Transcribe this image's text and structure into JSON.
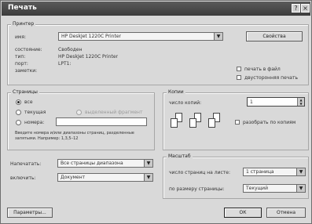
{
  "window": {
    "title": "Печать",
    "help_btn": "?",
    "close_btn": "×"
  },
  "printer": {
    "group_title": "Принтер",
    "name_label": "имя:",
    "name_value": "HP DeskJet 1220C Printer",
    "properties_btn": "Свойства",
    "status_label": "состояние:",
    "status_value": "Свободен",
    "type_label": "тип:",
    "type_value": "HP DeskJet 1220C Printer",
    "port_label": "порт:",
    "port_value": "LPT1:",
    "comment_label": "заметки:",
    "comment_value": "",
    "print_to_file": "печать в файл",
    "duplex": "двусторонняя печать"
  },
  "pages": {
    "group_title": "Страницы",
    "all": "все",
    "current": "текущая",
    "selection": "выделенный фрагмент",
    "numbers": "номера:",
    "hint": "Введите номера и/или диапазоны страниц, разделенные запятыми. Например: 1,3,5–12"
  },
  "copies": {
    "group_title": "Копии",
    "count_label": "число копий:",
    "count_value": "1",
    "collate": "разобрать по копиям"
  },
  "print_what": {
    "label": "Напечатать:",
    "value": "Все страницы диапазона"
  },
  "include": {
    "label": "включить:",
    "value": "Документ"
  },
  "scale": {
    "group_title": "Масштаб",
    "pages_per_sheet_label": "число страниц на листе:",
    "pages_per_sheet_value": "1 страница",
    "fit_to_label": "по размеру страницы:",
    "fit_to_value": "Текущий"
  },
  "buttons": {
    "params": "Параметры...",
    "ok": "ОК",
    "cancel": "Отмена"
  }
}
